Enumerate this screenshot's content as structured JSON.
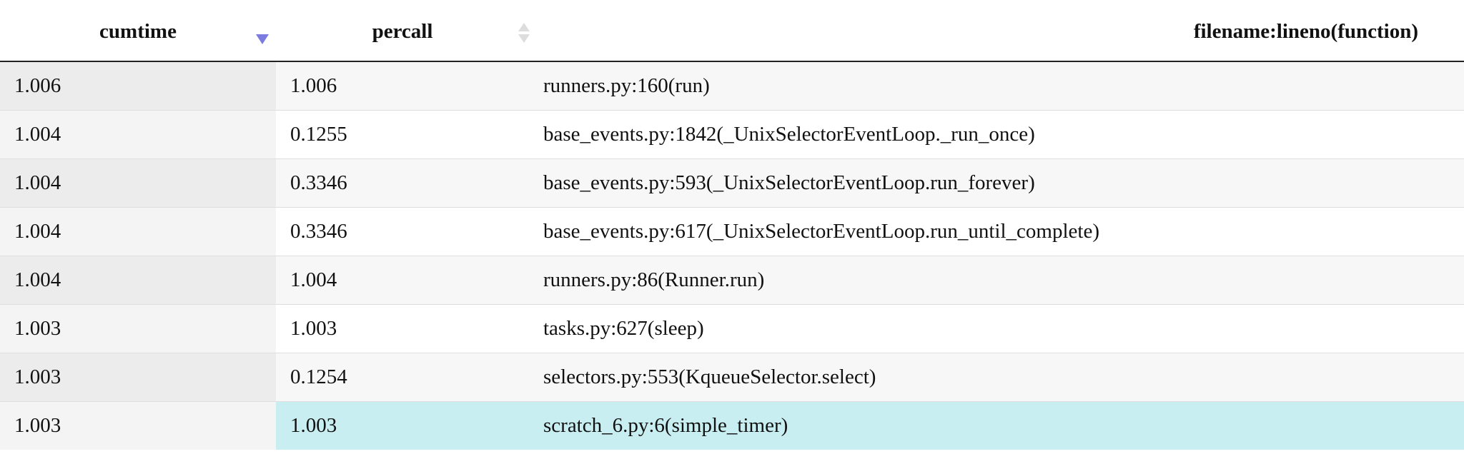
{
  "header": {
    "cumtime": "cumtime",
    "percall": "percall",
    "function": "filename:lineno(function)"
  },
  "rows": [
    {
      "cumtime": "1.006",
      "percall": "1.006",
      "function": "runners.py:160(run)"
    },
    {
      "cumtime": "1.004",
      "percall": "0.1255",
      "function": "base_events.py:1842(_UnixSelectorEventLoop._run_once)"
    },
    {
      "cumtime": "1.004",
      "percall": "0.3346",
      "function": "base_events.py:593(_UnixSelectorEventLoop.run_forever)"
    },
    {
      "cumtime": "1.004",
      "percall": "0.3346",
      "function": "base_events.py:617(_UnixSelectorEventLoop.run_until_complete)"
    },
    {
      "cumtime": "1.004",
      "percall": "1.004",
      "function": "runners.py:86(Runner.run)"
    },
    {
      "cumtime": "1.003",
      "percall": "1.003",
      "function": "tasks.py:627(sleep)"
    },
    {
      "cumtime": "1.003",
      "percall": "0.1254",
      "function": "selectors.py:553(KqueueSelector.select)"
    },
    {
      "cumtime": "1.003",
      "percall": "1.003",
      "function": "scratch_6.py:6(simple_timer)"
    }
  ],
  "colors": {
    "sort_active": "#7b7be0",
    "sort_inactive": "#dddddd",
    "highlight_row": "#c8eef1"
  },
  "icons": {
    "cumtime_sort": "sort-descending-icon",
    "percall_sort": "sort-unsorted-icon"
  }
}
